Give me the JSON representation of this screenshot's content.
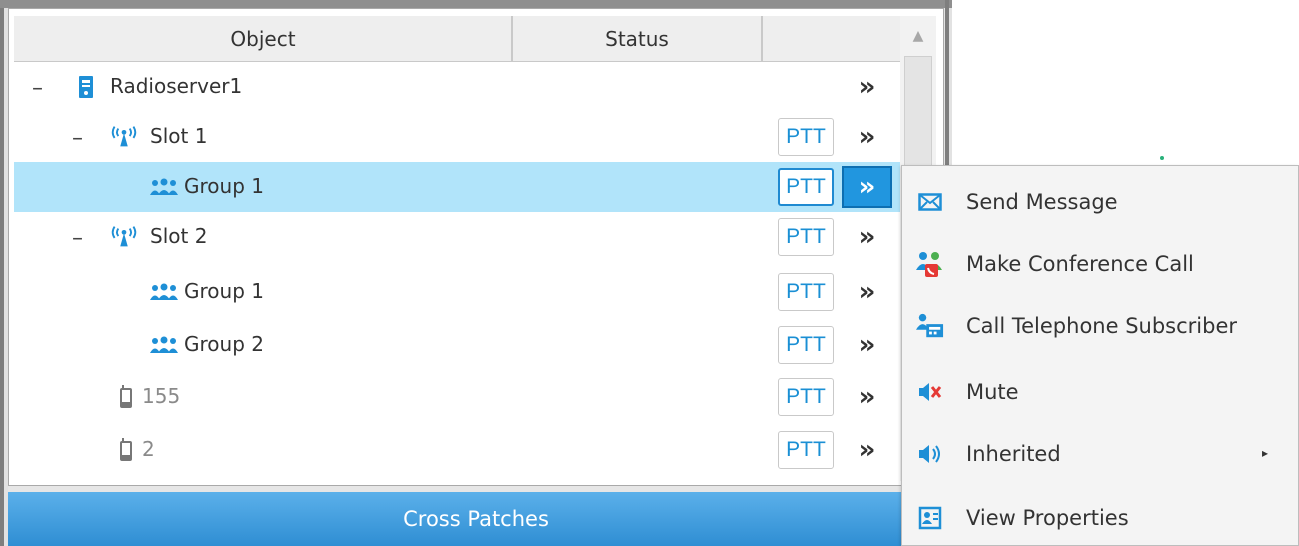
{
  "table": {
    "columns": [
      "Object",
      "Status",
      ""
    ],
    "rows": [
      {
        "expander": "–",
        "icon": "radio-server-icon",
        "label": "Radioserver1",
        "ptt": "",
        "more": "»"
      },
      {
        "expander": "–",
        "icon": "antenna-icon",
        "label": "Slot 1",
        "ptt": "PTT",
        "more": "»"
      },
      {
        "expander": "",
        "icon": "group-icon",
        "label": "Group 1",
        "ptt": "PTT",
        "more": "»",
        "selected": true
      },
      {
        "expander": "–",
        "icon": "antenna-icon",
        "label": "Slot 2",
        "ptt": "PTT",
        "more": "»"
      },
      {
        "expander": "",
        "icon": "group-icon",
        "label": "Group 1",
        "ptt": "PTT",
        "more": "»"
      },
      {
        "expander": "",
        "icon": "group-icon",
        "label": "Group 2",
        "ptt": "PTT",
        "more": "»"
      },
      {
        "expander": "",
        "icon": "radio-handset-icon",
        "label": "155",
        "ptt": "PTT",
        "more": "»"
      },
      {
        "expander": "",
        "icon": "radio-handset-icon",
        "label": "2",
        "ptt": "PTT",
        "more": "»"
      }
    ]
  },
  "scroll_up_glyph": "▲",
  "bottom_bar": {
    "label": "Cross Patches"
  },
  "context_menu": {
    "items": [
      {
        "icon": "envelope-icon",
        "label": "Send Message"
      },
      {
        "icon": "conference-call-icon",
        "label": "Make Conference Call"
      },
      {
        "icon": "telephone-subscriber-icon",
        "label": "Call Telephone Subscriber"
      },
      {
        "icon": "mute-icon",
        "label": "Mute"
      },
      {
        "icon": "speaker-icon",
        "label": "Inherited",
        "submenu_glyph": "▸"
      },
      {
        "icon": "properties-icon",
        "label": "View Properties"
      }
    ]
  },
  "colors": {
    "selected_row": "#b1e4fa",
    "accent": "#2196df",
    "ptt_text": "#1a8fd4"
  }
}
